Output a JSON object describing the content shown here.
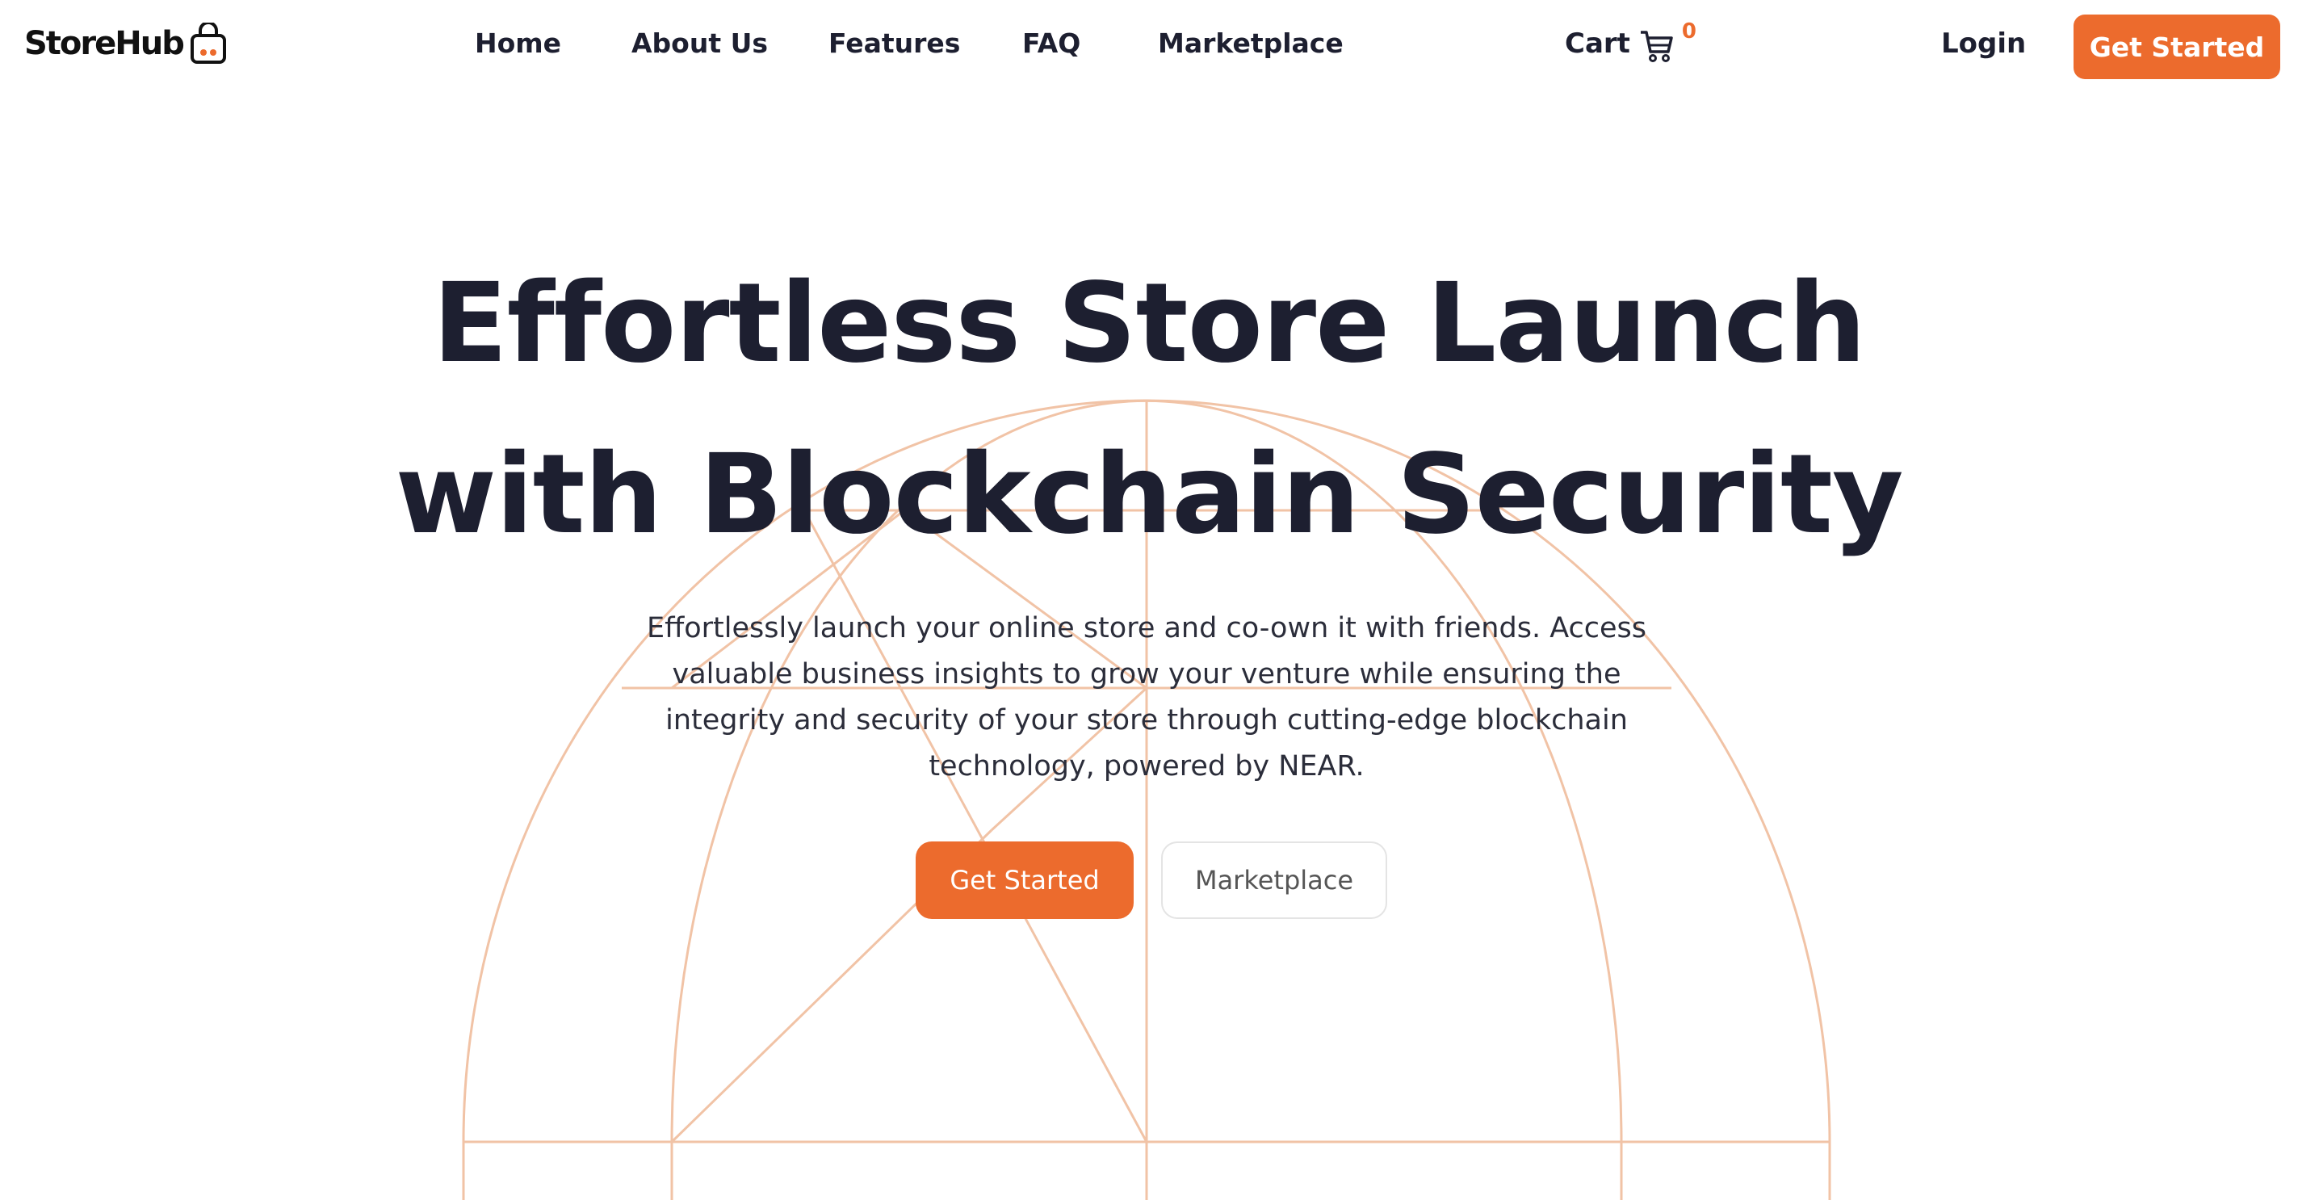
{
  "brand": {
    "name": "StoreHub",
    "accent_color": "#ec6b2d",
    "text_color": "#1d1f30"
  },
  "nav": {
    "items": [
      {
        "label": "Home"
      },
      {
        "label": "About Us"
      },
      {
        "label": "Features"
      },
      {
        "label": "FAQ"
      },
      {
        "label": "Marketplace"
      }
    ],
    "cart": {
      "label": "Cart",
      "count": "0",
      "icon": "cart-icon"
    },
    "login_label": "Login",
    "get_started_label": "Get Started"
  },
  "hero": {
    "title_line1": "Effortless Store Launch",
    "title_line2": "with Blockchain Security",
    "description": "Effortlessly launch your online store and co-own it with friends. Access valuable business insights to grow your venture while ensuring the integrity and security of your store through cutting-edge blockchain technology, powered by NEAR.",
    "primary_button": "Get Started",
    "secondary_button": "Marketplace"
  }
}
